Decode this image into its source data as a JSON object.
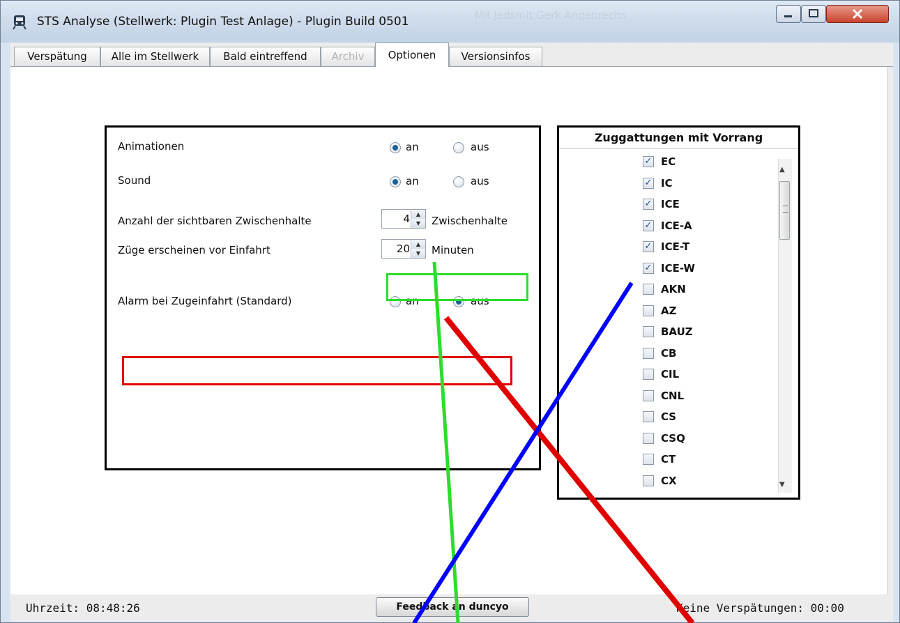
{
  "window": {
    "title": "STS Analyse (Stellwerk: Plugin Test Anlage) - Plugin Build 0501",
    "watermark": "Mit Jedsmit Gerk Angebrechs"
  },
  "tabs": [
    {
      "label": "Verspätung",
      "state": "normal"
    },
    {
      "label": "Alle im Stellwerk",
      "state": "normal"
    },
    {
      "label": "Bald eintreffend",
      "state": "normal"
    },
    {
      "label": "Archiv",
      "state": "disabled"
    },
    {
      "label": "Optionen",
      "state": "active"
    },
    {
      "label": "Versionsinfos",
      "state": "normal"
    }
  ],
  "options": {
    "animations": {
      "label": "Animationen",
      "on_label": "an",
      "off_label": "aus",
      "value": "an"
    },
    "sound": {
      "label": "Sound",
      "on_label": "an",
      "off_label": "aus",
      "value": "an"
    },
    "stops": {
      "label": "Anzahl der sichtbaren Zwischenhalte",
      "value": "4",
      "unit": "Zwischenhalte"
    },
    "appear": {
      "label": "Züge erscheinen vor Einfahrt",
      "value": "20",
      "unit": "Minuten"
    },
    "alarm": {
      "label": "Alarm bei Zugeinfahrt (Standard)",
      "on_label": "an",
      "off_label": "aus",
      "value": "aus"
    }
  },
  "trains": {
    "header": "Zuggattungen mit Vorrang",
    "items": [
      {
        "name": "EC",
        "checked": true
      },
      {
        "name": "IC",
        "checked": true
      },
      {
        "name": "ICE",
        "checked": true
      },
      {
        "name": "ICE-A",
        "checked": true
      },
      {
        "name": "ICE-T",
        "checked": true
      },
      {
        "name": "ICE-W",
        "checked": true
      },
      {
        "name": "AKN",
        "checked": false
      },
      {
        "name": "AZ",
        "checked": false
      },
      {
        "name": "BAUZ",
        "checked": false
      },
      {
        "name": "CB",
        "checked": false
      },
      {
        "name": "CIL",
        "checked": false
      },
      {
        "name": "CNL",
        "checked": false
      },
      {
        "name": "CS",
        "checked": false
      },
      {
        "name": "CSQ",
        "checked": false
      },
      {
        "name": "CT",
        "checked": false
      },
      {
        "name": "CX",
        "checked": false
      }
    ]
  },
  "status": {
    "time": "Uhrzeit: 08:48:26",
    "feedback": "Feedback an duncyo",
    "delay": "Keine Verspätungen: 00:00"
  },
  "colors": {
    "highlight_green": "#2ddc2d",
    "highlight_red": "#e00000",
    "annotation_blue": "#0000ff",
    "radio_selected": "#1f5f94"
  }
}
